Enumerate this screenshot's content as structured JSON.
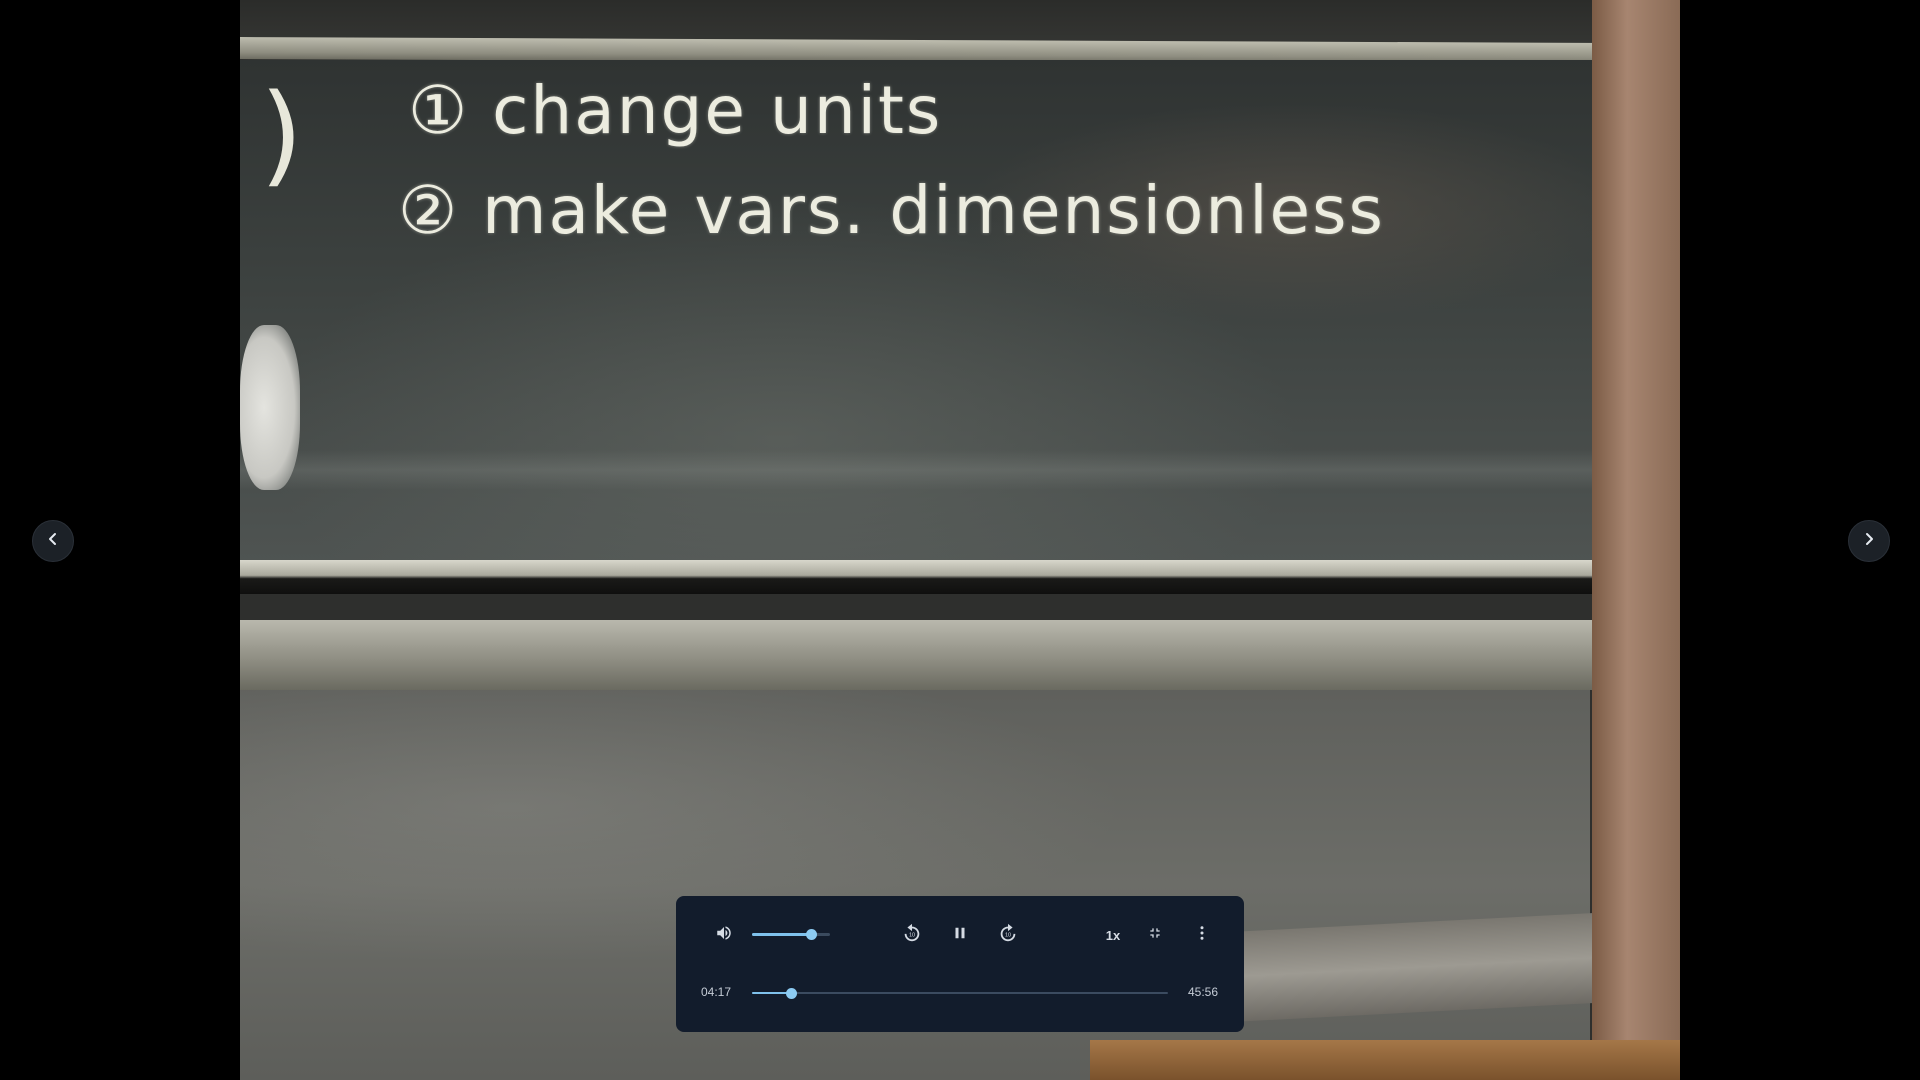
{
  "video": {
    "board_line_1": "① change units",
    "board_line_2": "② make vars. dimensionless"
  },
  "navigation": {
    "prev_icon": "chevron-left-icon",
    "next_icon": "chevron-right-icon"
  },
  "player": {
    "volume_level": 0.75,
    "playback_state": "playing",
    "speed_label": "1x",
    "current_time": "04:17",
    "total_time": "45:56",
    "progress_fraction": 0.093,
    "rewind_seconds": "10",
    "forward_seconds": "10",
    "icons": {
      "volume": "volume-up-icon",
      "rewind": "replay-10-icon",
      "pause": "pause-icon",
      "forward": "forward-10-icon",
      "exit_fullscreen": "exit-fullscreen-icon",
      "more": "more-vertical-icon"
    },
    "colors": {
      "panel": "#121c2c",
      "accent": "#8ccbf2",
      "text": "#c5ccd6"
    }
  }
}
